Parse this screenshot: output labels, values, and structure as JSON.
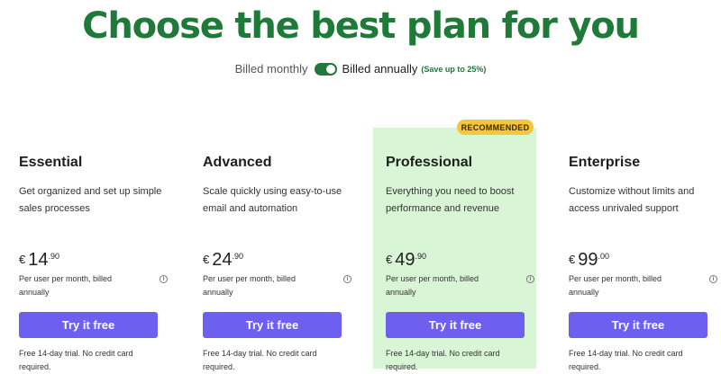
{
  "headline": "Choose the best plan for you",
  "billing": {
    "monthly": "Billed monthly",
    "annually": "Billed annually",
    "save": "(Save up to 25%)",
    "annual_selected": true
  },
  "badge": "RECOMMENDED",
  "plans": [
    {
      "name": "Essential",
      "desc": "Get organized and set up simple sales processes",
      "currency": "€",
      "amount": "14",
      "cents": ".90",
      "per": "Per user per month, billed annually",
      "button": "Try it free",
      "trial": "Free 14-day trial. No credit card required."
    },
    {
      "name": "Advanced",
      "desc": "Scale quickly using easy-to-use email and automation",
      "currency": "€",
      "amount": "24",
      "cents": ".90",
      "per": "Per user per month, billed annually",
      "button": "Try it free",
      "trial": "Free 14-day trial. No credit card required."
    },
    {
      "name": "Professional",
      "desc": "Everything you need to boost performance and revenue",
      "currency": "€",
      "amount": "49",
      "cents": ".90",
      "per": "Per user per month, billed annually",
      "button": "Try it free",
      "trial": "Free 14-day trial. No credit card required."
    },
    {
      "name": "Enterprise",
      "desc": "Customize without limits and access unrivaled support",
      "currency": "€",
      "amount": "99",
      "cents": ".00",
      "per": "Per user per month, billed annually",
      "button": "Try it free",
      "trial": "Free 14-day trial. No credit card required."
    }
  ],
  "icons": {
    "info": "info-icon"
  },
  "colors": {
    "brand_green": "#1f7a3a",
    "button": "#6d5ff0",
    "badge": "#f5c53a",
    "recommended_bg": "#d8f5d6"
  }
}
